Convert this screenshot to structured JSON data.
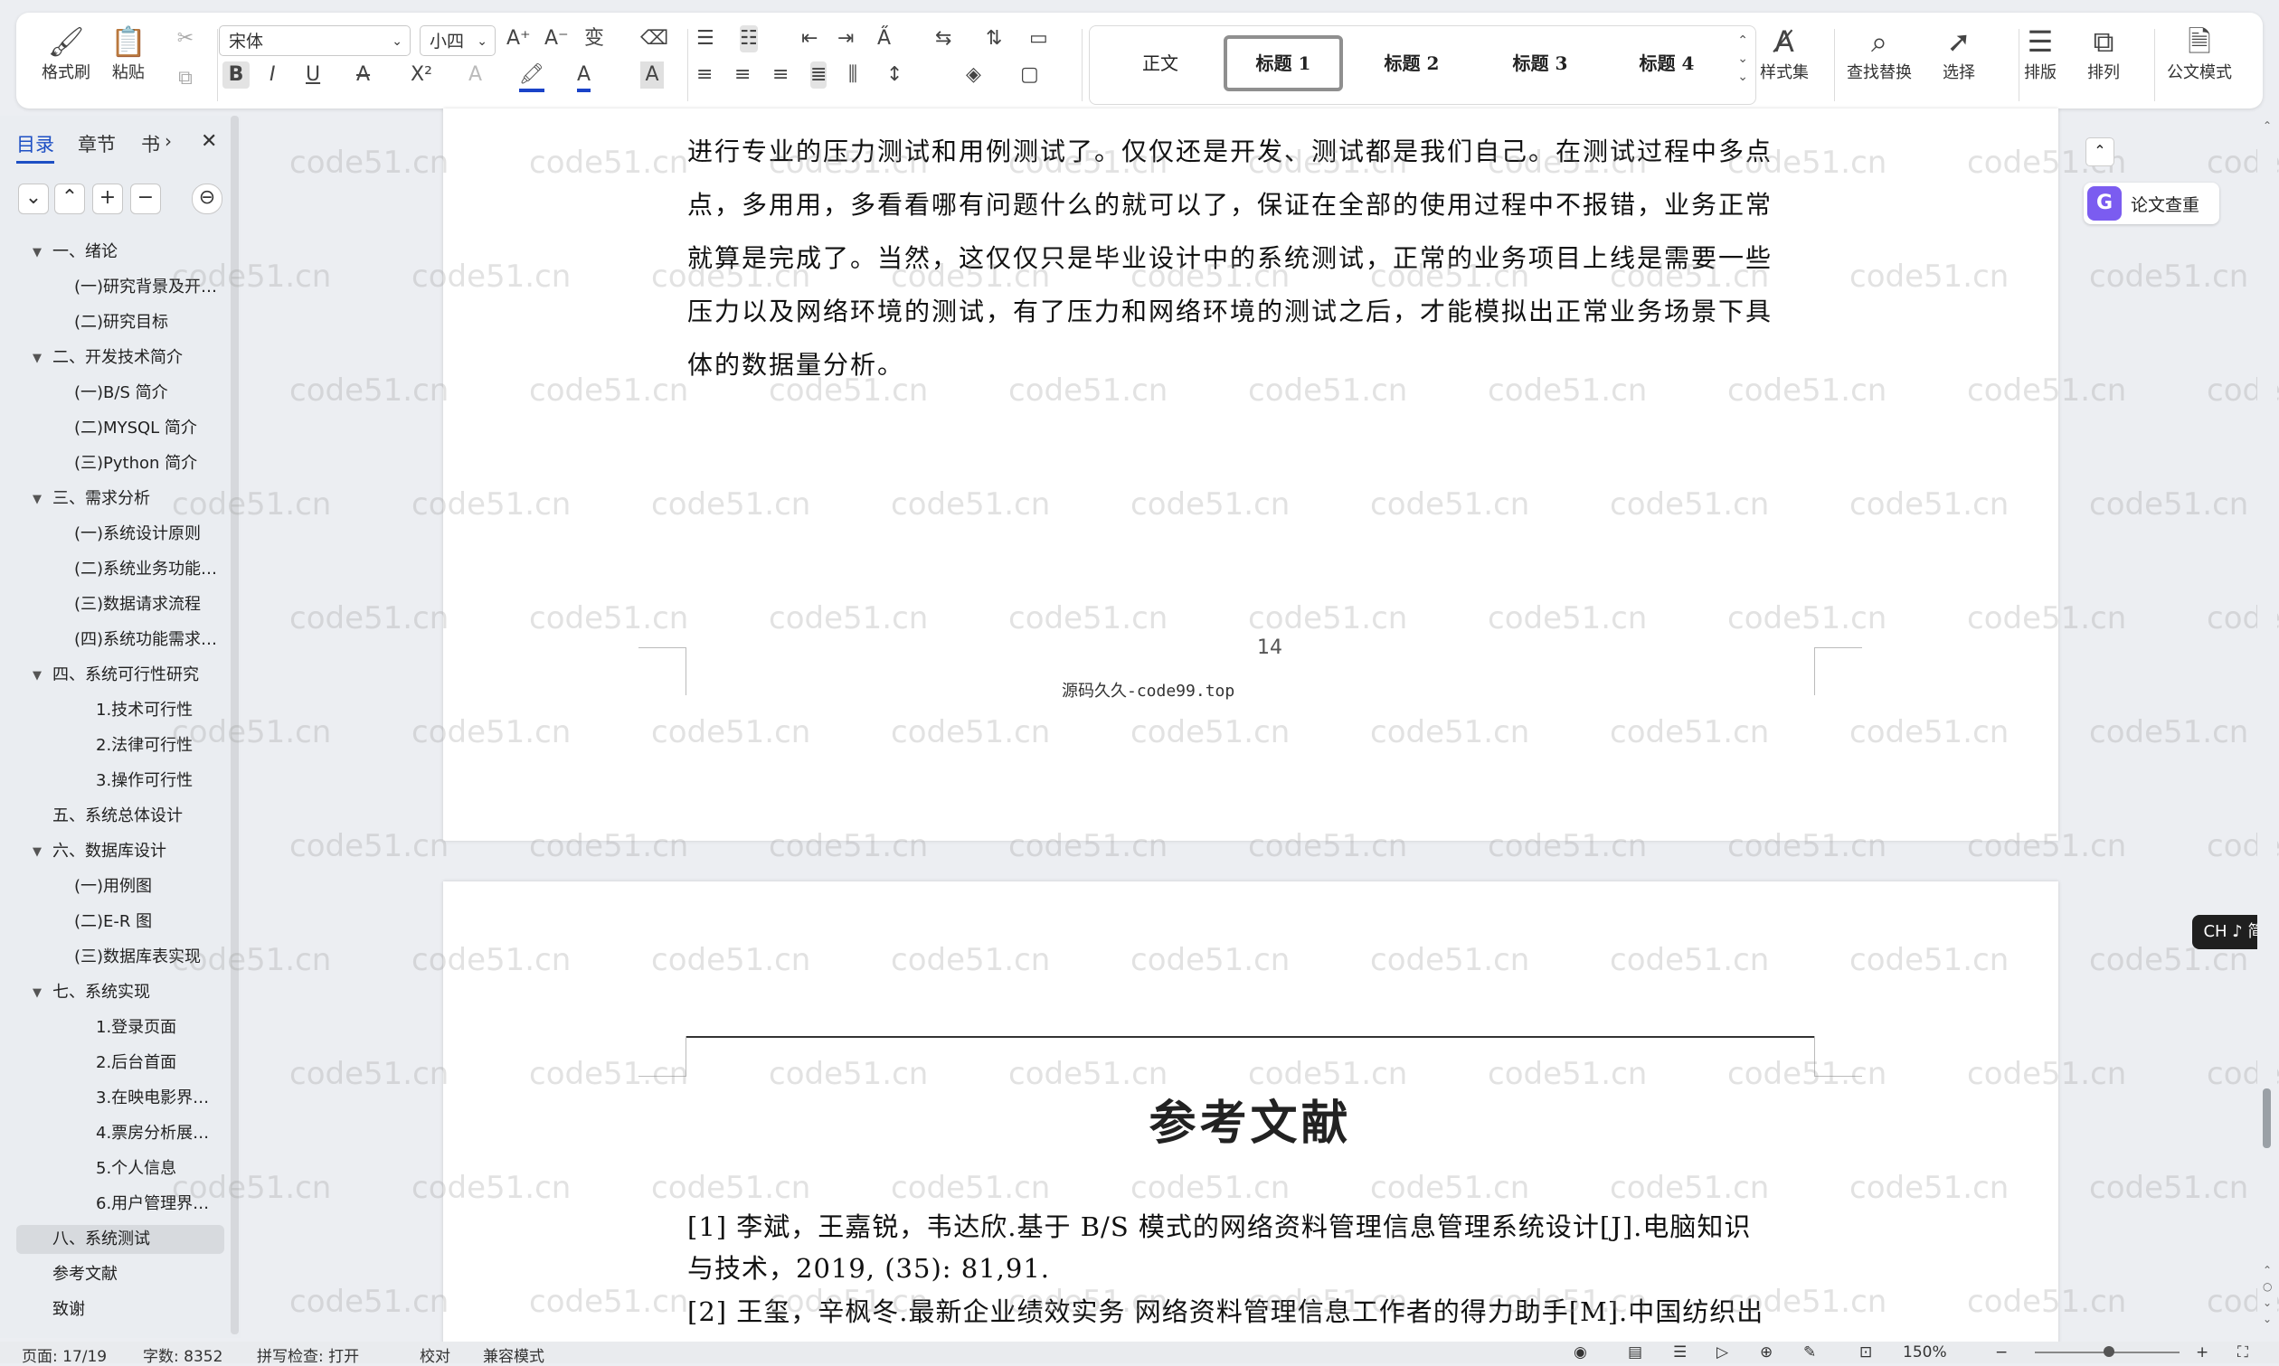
{
  "ribbon": {
    "format_painter": "格式刷",
    "paste": "粘贴",
    "font_name": "宋体",
    "font_size": "小四",
    "styles": [
      "正文",
      "标题 1",
      "标题 2",
      "标题 3",
      "标题 4"
    ],
    "style_set": "样式集",
    "find_replace": "查找替换",
    "select": "选择",
    "layout": "排版",
    "arrange": "排列",
    "doc_mode": "公文模式"
  },
  "sidebar": {
    "tabs": [
      "目录",
      "章节",
      "书"
    ],
    "toc": [
      {
        "label": "一、绪论",
        "level": 1,
        "caret": true
      },
      {
        "label": "(一)研究背景及开…",
        "level": 2
      },
      {
        "label": "(二)研究目标",
        "level": 2
      },
      {
        "label": "二、开发技术简介",
        "level": 1,
        "caret": true
      },
      {
        "label": "(一)B/S 简介",
        "level": 2
      },
      {
        "label": "(二)MYSQL 简介",
        "level": 2
      },
      {
        "label": "(三)Python 简介",
        "level": 2
      },
      {
        "label": "三、需求分析",
        "level": 1,
        "caret": true
      },
      {
        "label": "(一)系统设计原则",
        "level": 2
      },
      {
        "label": "(二)系统业务功能…",
        "level": 2
      },
      {
        "label": "(三)数据请求流程",
        "level": 2
      },
      {
        "label": "(四)系统功能需求…",
        "level": 2
      },
      {
        "label": "四、系统可行性研究",
        "level": 1,
        "caret": true
      },
      {
        "label": "1.技术可行性",
        "level": 3
      },
      {
        "label": "2.法律可行性",
        "level": 3
      },
      {
        "label": "3.操作可行性",
        "level": 3
      },
      {
        "label": "五、系统总体设计",
        "level": 1
      },
      {
        "label": "六、数据库设计",
        "level": 1,
        "caret": true
      },
      {
        "label": "(一)用例图",
        "level": 2
      },
      {
        "label": "(二)E-R 图",
        "level": 2
      },
      {
        "label": "(三)数据库表实现",
        "level": 2
      },
      {
        "label": "七、系统实现",
        "level": 1,
        "caret": true
      },
      {
        "label": "1.登录页面",
        "level": 3
      },
      {
        "label": "2.后台首面",
        "level": 3
      },
      {
        "label": "3.在映电影界…",
        "level": 3
      },
      {
        "label": "4.票房分析展…",
        "level": 3
      },
      {
        "label": "5.个人信息",
        "level": 3
      },
      {
        "label": "6.用户管理界…",
        "level": 3
      },
      {
        "label": "八、系统测试",
        "level": 1,
        "selected": true
      },
      {
        "label": "参考文献",
        "level": 1
      },
      {
        "label": "致谢",
        "level": 1
      }
    ]
  },
  "document": {
    "page1_lines": [
      "进行专业的压力测试和用例测试了。仅仅还是开发、测试都是我们自己。在测试过程中多点",
      "点，多用用，多看看哪有问题什么的就可以了，保证在全部的使用过程中不报错，业务正常",
      "就算是完成了。当然，这仅仅只是毕业设计中的系统测试，正常的业务项目上线是需要一些",
      "压力以及网络环境的测试，有了压力和网络环境的测试之后，才能模拟出正常业务场景下具",
      "体的数据量分析。"
    ],
    "page_number": "14",
    "footer": "源码久久-code99.top",
    "ref_title": "参考文献",
    "references": [
      "[1] 李斌，王嘉锐，韦达欣.基于 B/S 模式的网络资料管理信息管理系统设计[J].电脑知识",
      "与技术，2019, (35): 81,91.",
      "[2] 王玺，辛枫冬.最新企业绩效实务 网络资料管理信息工作者的得力助手[M].中国纺织出"
    ],
    "watermark": "code51.cn"
  },
  "right_panel": {
    "plagiarism_check": "论文查重",
    "ime": "CH ♪ 简"
  },
  "status": {
    "page": "页面: 17/19",
    "words": "字数: 8352",
    "spell": "拼写检查: 打开",
    "proof": "校对",
    "compat": "兼容模式",
    "zoom": "150%"
  },
  "colors": {
    "accent": "#2b64d9",
    "ime_bg": "#1f1f1f",
    "plag_icon": "#7b5cf0"
  }
}
